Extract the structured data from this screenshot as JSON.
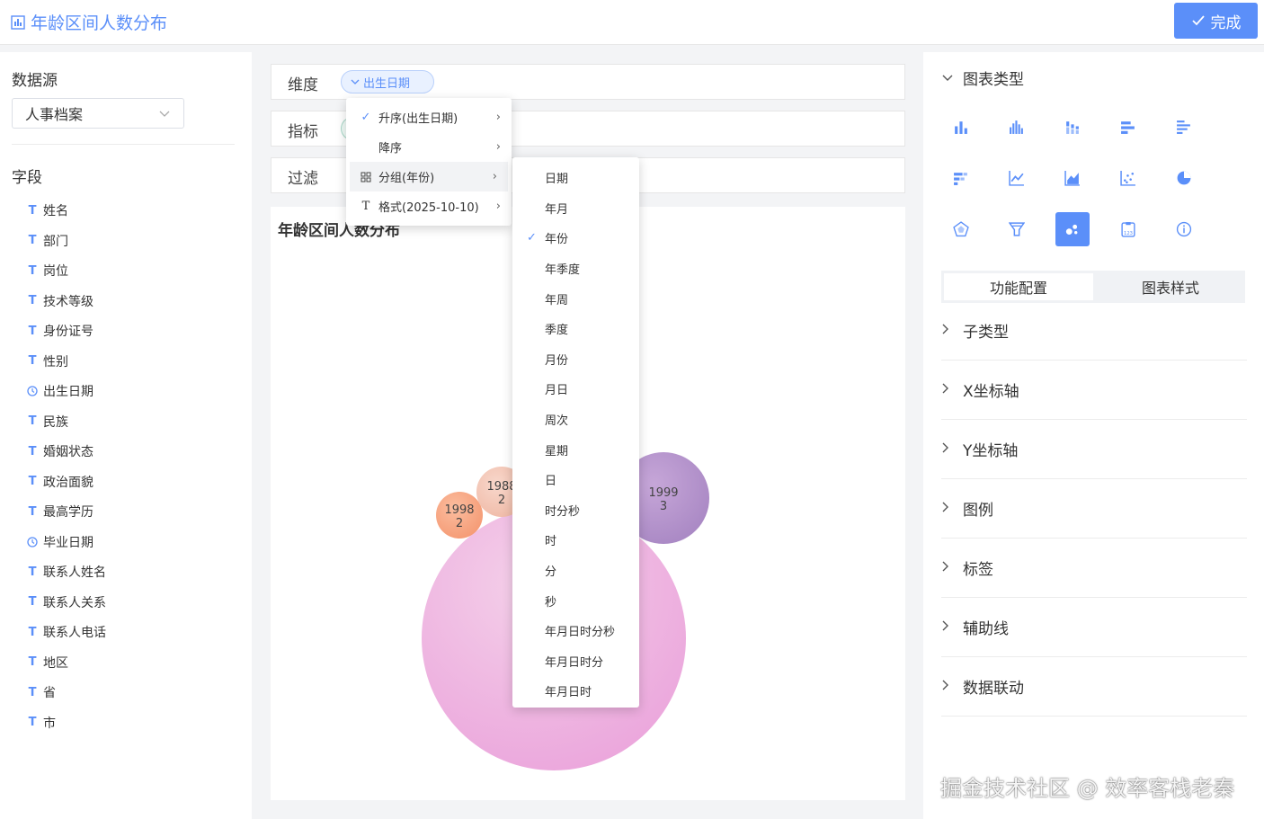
{
  "header": {
    "title": "年龄区间人数分布",
    "done_label": "完成"
  },
  "left": {
    "datasource_label": "数据源",
    "datasource_value": "人事档案",
    "fields_label": "字段",
    "fields": [
      {
        "name": "姓名",
        "type": "text"
      },
      {
        "name": "部门",
        "type": "text"
      },
      {
        "name": "岗位",
        "type": "text"
      },
      {
        "name": "技术等级",
        "type": "text"
      },
      {
        "name": "身份证号",
        "type": "text"
      },
      {
        "name": "性别",
        "type": "text"
      },
      {
        "name": "出生日期",
        "type": "date"
      },
      {
        "name": "民族",
        "type": "text"
      },
      {
        "name": "婚姻状态",
        "type": "text"
      },
      {
        "name": "政治面貌",
        "type": "text"
      },
      {
        "name": "最高学历",
        "type": "text"
      },
      {
        "name": "毕业日期",
        "type": "date"
      },
      {
        "name": "联系人姓名",
        "type": "text"
      },
      {
        "name": "联系人关系",
        "type": "text"
      },
      {
        "name": "联系人电话",
        "type": "text"
      },
      {
        "name": "地区",
        "type": "text"
      },
      {
        "name": "省",
        "type": "text"
      },
      {
        "name": "市",
        "type": "text"
      }
    ]
  },
  "center": {
    "dimension_label": "维度",
    "dimension_tag": "出生日期",
    "metric_label": "指标",
    "filter_label": "过滤",
    "chart_title": "年龄区间人数分布"
  },
  "menu": {
    "items": [
      {
        "label": "升序(出生日期)",
        "icon": "check-icon"
      },
      {
        "label": "降序",
        "icon": ""
      },
      {
        "label": "分组(年份)",
        "icon": "group-icon"
      },
      {
        "label": "格式(2025-10-10)",
        "icon": "text-icon"
      }
    ],
    "submenu": [
      "日期",
      "年月",
      "年份",
      "年季度",
      "年周",
      "季度",
      "月份",
      "月日",
      "周次",
      "星期",
      "日",
      "时分秒",
      "时",
      "分",
      "秒",
      "年月日时分秒",
      "年月日时分",
      "年月日时"
    ],
    "submenu_selected": "年份"
  },
  "chart_data": {
    "type": "bubble",
    "series": [
      {
        "label": "1998",
        "value": 2,
        "color": "#f8a07a"
      },
      {
        "label": "1988",
        "value": 2,
        "color": "#f3c4b4"
      },
      {
        "label": "1999",
        "value": 3,
        "color": "#b796cc"
      },
      {
        "label": "",
        "value": null,
        "color": "#eeaad8"
      }
    ]
  },
  "right": {
    "chart_type_label": "图表类型",
    "tab_function": "功能配置",
    "tab_style": "图表样式",
    "sections": [
      "子类型",
      "X坐标轴",
      "Y坐标轴",
      "图例",
      "标签",
      "辅助线",
      "数据联动"
    ]
  },
  "watermark": "掘金技术社区 @ 效率客栈老秦"
}
